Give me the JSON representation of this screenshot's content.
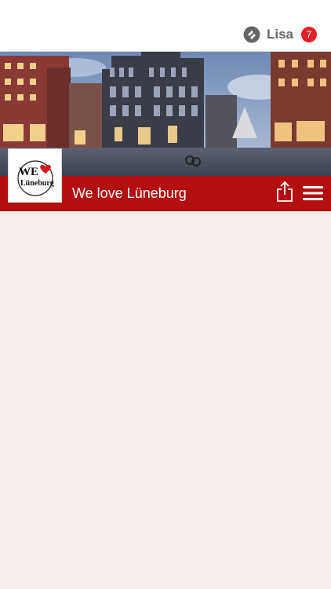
{
  "header": {
    "user_name": "Lisa",
    "notification_count": "7"
  },
  "community": {
    "title": "We love Lüneburg",
    "logo_text_top": "WE",
    "logo_text_bottom": "Lüneburg"
  },
  "colors": {
    "brand_red": "#b30f0f",
    "badge_red": "#e0222a",
    "background": "#f7ecec"
  },
  "icons": [
    "app-logo-icon",
    "share-icon",
    "hamburger-menu-icon",
    "heart-icon"
  ]
}
